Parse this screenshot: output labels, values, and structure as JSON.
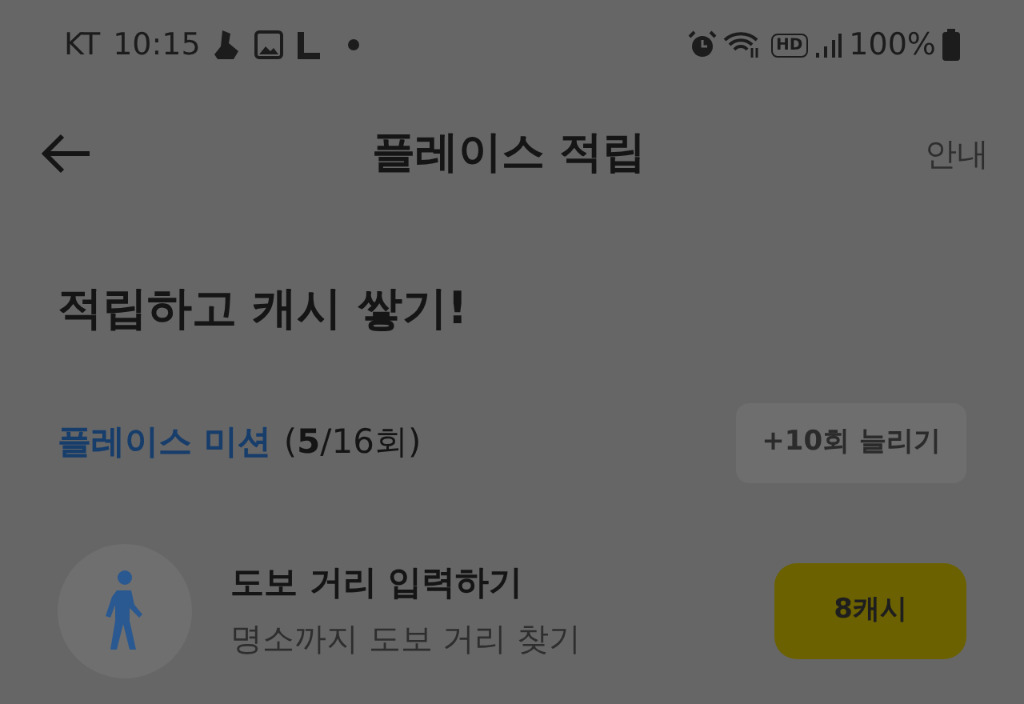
{
  "status_bar": {
    "carrier": "KT",
    "time": "10:15",
    "hd": "HD",
    "battery": "100%"
  },
  "header": {
    "title": "플레이스 적립",
    "action": "안내"
  },
  "heading": "적립하고 캐시 쌓기!",
  "mission": {
    "title": "플레이스 미션",
    "count": "(**5**/16회)",
    "button": "+10회 늘리기"
  },
  "items": [
    {
      "title": "도보 거리 입력하기",
      "subtitle": "명소까지 도보 거리 찾기",
      "reward": "8캐시"
    }
  ]
}
